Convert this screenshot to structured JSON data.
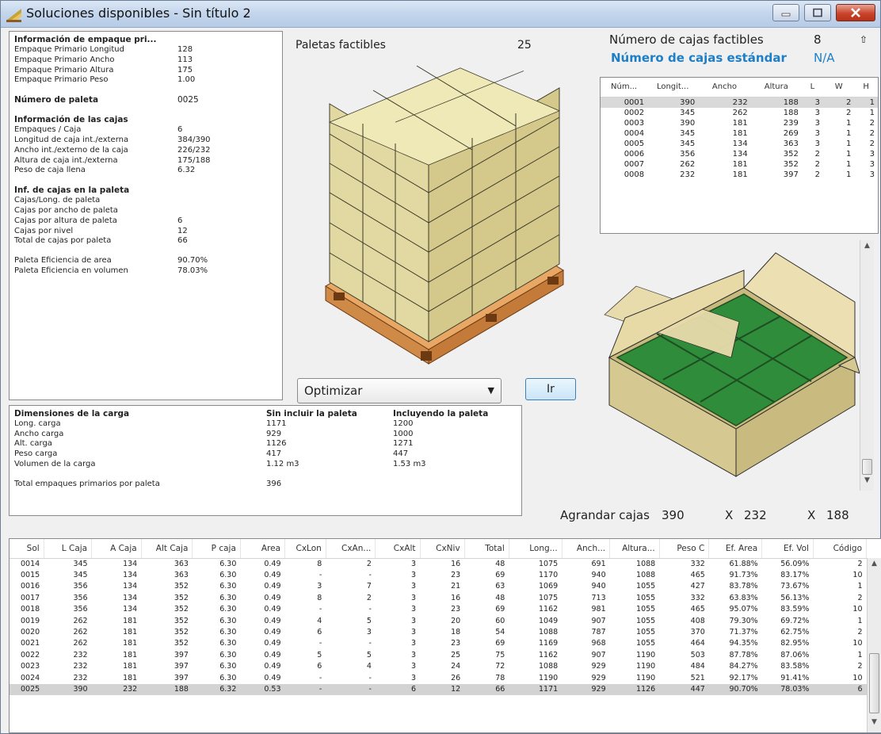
{
  "window": {
    "title": "Soluciones disponibles - Sin título 2"
  },
  "info": {
    "sections": [
      {
        "heading": "Información de empaque pri...",
        "rows": [
          {
            "label": "Empaque Primario Longitud",
            "value": "128"
          },
          {
            "label": "Empaque Primario Ancho",
            "value": "113"
          },
          {
            "label": "Empaque Primario Altura",
            "value": "175"
          },
          {
            "label": "Empaque Primario Peso",
            "value": "1.00"
          }
        ]
      },
      {
        "heading_value": {
          "label": "Número de paleta",
          "value": "0025"
        }
      },
      {
        "heading": "Información de las cajas",
        "rows": [
          {
            "label": "Empaques / Caja",
            "value": "6"
          },
          {
            "label": "Longitud de caja int./externa",
            "value": "384/390"
          },
          {
            "label": "Ancho int./externo de la caja",
            "value": "226/232"
          },
          {
            "label": "Altura de caja int./externa",
            "value": "175/188"
          },
          {
            "label": "Peso de caja llena",
            "value": "6.32"
          }
        ]
      },
      {
        "heading": "Inf. de cajas en la paleta",
        "rows": [
          {
            "label": "Cajas/Long. de paleta",
            "value": ""
          },
          {
            "label": "Cajas por ancho de paleta",
            "value": ""
          },
          {
            "label": "Cajas por altura de paleta",
            "value": "6"
          },
          {
            "label": "Cajas por nivel",
            "value": "12"
          },
          {
            "label": "Total de cajas por paleta",
            "value": "66"
          }
        ]
      },
      {
        "rows": [
          {
            "label": "Paleta Eficiencia de area",
            "value": "90.70%"
          },
          {
            "label": "Paleta Eficiencia en volumen",
            "value": "78.03%"
          }
        ]
      }
    ]
  },
  "pallets": {
    "label": "Paletas factibles",
    "count": "25"
  },
  "optimize": {
    "selected": "Optimizar",
    "go_label": "Ir"
  },
  "load": {
    "headers": [
      "Dimensiones de la carga",
      "Sin incluir la paleta",
      "Incluyendo la paleta"
    ],
    "rows": [
      [
        "Long. carga",
        "1171",
        "1200"
      ],
      [
        "Ancho carga",
        "929",
        "1000"
      ],
      [
        "Alt. carga",
        "1126",
        "1271"
      ],
      [
        "Peso carga",
        "417",
        "447"
      ],
      [
        "Volumen de la carga",
        "1.12 m3",
        "1.53 m3"
      ]
    ],
    "total": [
      "Total empaques primarios por paleta",
      "396",
      ""
    ]
  },
  "boxes": {
    "feasible_label": "Número de cajas factibles",
    "feasible_value": "8",
    "standard_label": "Número de cajas estándar",
    "standard_value": "N/A",
    "columns": [
      "Núm...",
      "Longit...",
      "Ancho",
      "Altura",
      "L",
      "W",
      "H"
    ],
    "rows": [
      [
        "0001",
        "390",
        "232",
        "188",
        "3",
        "2",
        "1"
      ],
      [
        "0002",
        "345",
        "262",
        "188",
        "3",
        "2",
        "1"
      ],
      [
        "0003",
        "390",
        "181",
        "239",
        "3",
        "1",
        "2"
      ],
      [
        "0004",
        "345",
        "181",
        "269",
        "3",
        "1",
        "2"
      ],
      [
        "0005",
        "345",
        "134",
        "363",
        "3",
        "1",
        "2"
      ],
      [
        "0006",
        "356",
        "134",
        "352",
        "2",
        "1",
        "3"
      ],
      [
        "0007",
        "262",
        "181",
        "352",
        "2",
        "1",
        "3"
      ],
      [
        "0008",
        "232",
        "181",
        "397",
        "2",
        "1",
        "3"
      ]
    ],
    "selected_index": 0
  },
  "enlarge": {
    "label": "Agrandar cajas",
    "l": "390",
    "x1": "X",
    "w": "232",
    "x2": "X",
    "h": "188"
  },
  "grid": {
    "columns": [
      "Sol",
      "L Caja",
      "A Caja",
      "Alt Caja",
      "P caja",
      "Area",
      "CxLon",
      "CxAn...",
      "CxAlt",
      "CxNiv",
      "Total",
      "Long...",
      "Anch...",
      "Altura...",
      "Peso C",
      "Ef. Area",
      "Ef. Vol",
      "Código"
    ],
    "rows": [
      [
        "0014",
        "345",
        "134",
        "363",
        "6.30",
        "0.49",
        "8",
        "2",
        "3",
        "16",
        "48",
        "1075",
        "691",
        "1088",
        "332",
        "61.88%",
        "56.09%",
        "2"
      ],
      [
        "0015",
        "345",
        "134",
        "363",
        "6.30",
        "0.49",
        "-",
        "-",
        "3",
        "23",
        "69",
        "1170",
        "940",
        "1088",
        "465",
        "91.73%",
        "83.17%",
        "10"
      ],
      [
        "0016",
        "356",
        "134",
        "352",
        "6.30",
        "0.49",
        "3",
        "7",
        "3",
        "21",
        "63",
        "1069",
        "940",
        "1055",
        "427",
        "83.78%",
        "73.67%",
        "1"
      ],
      [
        "0017",
        "356",
        "134",
        "352",
        "6.30",
        "0.49",
        "8",
        "2",
        "3",
        "16",
        "48",
        "1075",
        "713",
        "1055",
        "332",
        "63.83%",
        "56.13%",
        "2"
      ],
      [
        "0018",
        "356",
        "134",
        "352",
        "6.30",
        "0.49",
        "-",
        "-",
        "3",
        "23",
        "69",
        "1162",
        "981",
        "1055",
        "465",
        "95.07%",
        "83.59%",
        "10"
      ],
      [
        "0019",
        "262",
        "181",
        "352",
        "6.30",
        "0.49",
        "4",
        "5",
        "3",
        "20",
        "60",
        "1049",
        "907",
        "1055",
        "408",
        "79.30%",
        "69.72%",
        "1"
      ],
      [
        "0020",
        "262",
        "181",
        "352",
        "6.30",
        "0.49",
        "6",
        "3",
        "3",
        "18",
        "54",
        "1088",
        "787",
        "1055",
        "370",
        "71.37%",
        "62.75%",
        "2"
      ],
      [
        "0021",
        "262",
        "181",
        "352",
        "6.30",
        "0.49",
        "-",
        "-",
        "3",
        "23",
        "69",
        "1169",
        "968",
        "1055",
        "464",
        "94.35%",
        "82.95%",
        "10"
      ],
      [
        "0022",
        "232",
        "181",
        "397",
        "6.30",
        "0.49",
        "5",
        "5",
        "3",
        "25",
        "75",
        "1162",
        "907",
        "1190",
        "503",
        "87.78%",
        "87.06%",
        "1"
      ],
      [
        "0023",
        "232",
        "181",
        "397",
        "6.30",
        "0.49",
        "6",
        "4",
        "3",
        "24",
        "72",
        "1088",
        "929",
        "1190",
        "484",
        "84.27%",
        "83.58%",
        "2"
      ],
      [
        "0024",
        "232",
        "181",
        "397",
        "6.30",
        "0.49",
        "-",
        "-",
        "3",
        "26",
        "78",
        "1190",
        "929",
        "1190",
        "521",
        "92.17%",
        "91.41%",
        "10"
      ],
      [
        "0025",
        "390",
        "232",
        "188",
        "6.32",
        "0.53",
        "-",
        "-",
        "6",
        "12",
        "66",
        "1171",
        "929",
        "1126",
        "447",
        "90.70%",
        "78.03%",
        "6"
      ]
    ],
    "selected_index": 11
  }
}
